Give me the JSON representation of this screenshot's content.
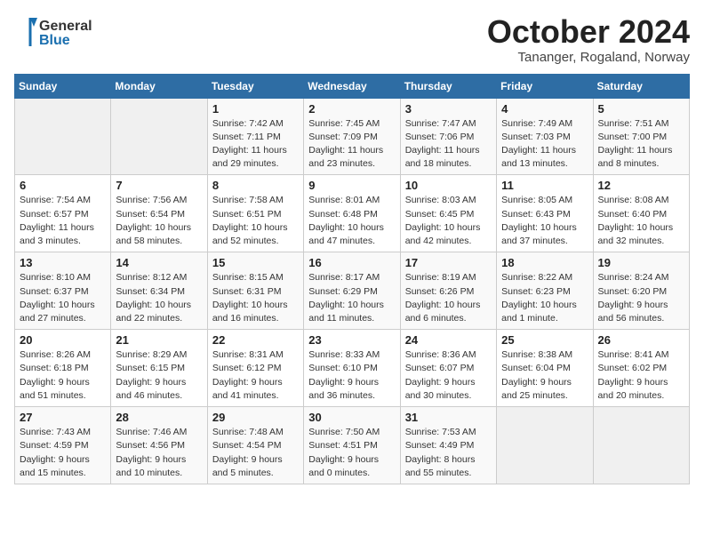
{
  "header": {
    "logo_general": "General",
    "logo_blue": "Blue",
    "month_title": "October 2024",
    "subtitle": "Tananger, Rogaland, Norway"
  },
  "weekdays": [
    "Sunday",
    "Monday",
    "Tuesday",
    "Wednesday",
    "Thursday",
    "Friday",
    "Saturday"
  ],
  "weeks": [
    [
      {
        "day": "",
        "detail": ""
      },
      {
        "day": "",
        "detail": ""
      },
      {
        "day": "1",
        "detail": "Sunrise: 7:42 AM\nSunset: 7:11 PM\nDaylight: 11 hours\nand 29 minutes."
      },
      {
        "day": "2",
        "detail": "Sunrise: 7:45 AM\nSunset: 7:09 PM\nDaylight: 11 hours\nand 23 minutes."
      },
      {
        "day": "3",
        "detail": "Sunrise: 7:47 AM\nSunset: 7:06 PM\nDaylight: 11 hours\nand 18 minutes."
      },
      {
        "day": "4",
        "detail": "Sunrise: 7:49 AM\nSunset: 7:03 PM\nDaylight: 11 hours\nand 13 minutes."
      },
      {
        "day": "5",
        "detail": "Sunrise: 7:51 AM\nSunset: 7:00 PM\nDaylight: 11 hours\nand 8 minutes."
      }
    ],
    [
      {
        "day": "6",
        "detail": "Sunrise: 7:54 AM\nSunset: 6:57 PM\nDaylight: 11 hours\nand 3 minutes."
      },
      {
        "day": "7",
        "detail": "Sunrise: 7:56 AM\nSunset: 6:54 PM\nDaylight: 10 hours\nand 58 minutes."
      },
      {
        "day": "8",
        "detail": "Sunrise: 7:58 AM\nSunset: 6:51 PM\nDaylight: 10 hours\nand 52 minutes."
      },
      {
        "day": "9",
        "detail": "Sunrise: 8:01 AM\nSunset: 6:48 PM\nDaylight: 10 hours\nand 47 minutes."
      },
      {
        "day": "10",
        "detail": "Sunrise: 8:03 AM\nSunset: 6:45 PM\nDaylight: 10 hours\nand 42 minutes."
      },
      {
        "day": "11",
        "detail": "Sunrise: 8:05 AM\nSunset: 6:43 PM\nDaylight: 10 hours\nand 37 minutes."
      },
      {
        "day": "12",
        "detail": "Sunrise: 8:08 AM\nSunset: 6:40 PM\nDaylight: 10 hours\nand 32 minutes."
      }
    ],
    [
      {
        "day": "13",
        "detail": "Sunrise: 8:10 AM\nSunset: 6:37 PM\nDaylight: 10 hours\nand 27 minutes."
      },
      {
        "day": "14",
        "detail": "Sunrise: 8:12 AM\nSunset: 6:34 PM\nDaylight: 10 hours\nand 22 minutes."
      },
      {
        "day": "15",
        "detail": "Sunrise: 8:15 AM\nSunset: 6:31 PM\nDaylight: 10 hours\nand 16 minutes."
      },
      {
        "day": "16",
        "detail": "Sunrise: 8:17 AM\nSunset: 6:29 PM\nDaylight: 10 hours\nand 11 minutes."
      },
      {
        "day": "17",
        "detail": "Sunrise: 8:19 AM\nSunset: 6:26 PM\nDaylight: 10 hours\nand 6 minutes."
      },
      {
        "day": "18",
        "detail": "Sunrise: 8:22 AM\nSunset: 6:23 PM\nDaylight: 10 hours\nand 1 minute."
      },
      {
        "day": "19",
        "detail": "Sunrise: 8:24 AM\nSunset: 6:20 PM\nDaylight: 9 hours\nand 56 minutes."
      }
    ],
    [
      {
        "day": "20",
        "detail": "Sunrise: 8:26 AM\nSunset: 6:18 PM\nDaylight: 9 hours\nand 51 minutes."
      },
      {
        "day": "21",
        "detail": "Sunrise: 8:29 AM\nSunset: 6:15 PM\nDaylight: 9 hours\nand 46 minutes."
      },
      {
        "day": "22",
        "detail": "Sunrise: 8:31 AM\nSunset: 6:12 PM\nDaylight: 9 hours\nand 41 minutes."
      },
      {
        "day": "23",
        "detail": "Sunrise: 8:33 AM\nSunset: 6:10 PM\nDaylight: 9 hours\nand 36 minutes."
      },
      {
        "day": "24",
        "detail": "Sunrise: 8:36 AM\nSunset: 6:07 PM\nDaylight: 9 hours\nand 30 minutes."
      },
      {
        "day": "25",
        "detail": "Sunrise: 8:38 AM\nSunset: 6:04 PM\nDaylight: 9 hours\nand 25 minutes."
      },
      {
        "day": "26",
        "detail": "Sunrise: 8:41 AM\nSunset: 6:02 PM\nDaylight: 9 hours\nand 20 minutes."
      }
    ],
    [
      {
        "day": "27",
        "detail": "Sunrise: 7:43 AM\nSunset: 4:59 PM\nDaylight: 9 hours\nand 15 minutes."
      },
      {
        "day": "28",
        "detail": "Sunrise: 7:46 AM\nSunset: 4:56 PM\nDaylight: 9 hours\nand 10 minutes."
      },
      {
        "day": "29",
        "detail": "Sunrise: 7:48 AM\nSunset: 4:54 PM\nDaylight: 9 hours\nand 5 minutes."
      },
      {
        "day": "30",
        "detail": "Sunrise: 7:50 AM\nSunset: 4:51 PM\nDaylight: 9 hours\nand 0 minutes."
      },
      {
        "day": "31",
        "detail": "Sunrise: 7:53 AM\nSunset: 4:49 PM\nDaylight: 8 hours\nand 55 minutes."
      },
      {
        "day": "",
        "detail": ""
      },
      {
        "day": "",
        "detail": ""
      }
    ]
  ]
}
